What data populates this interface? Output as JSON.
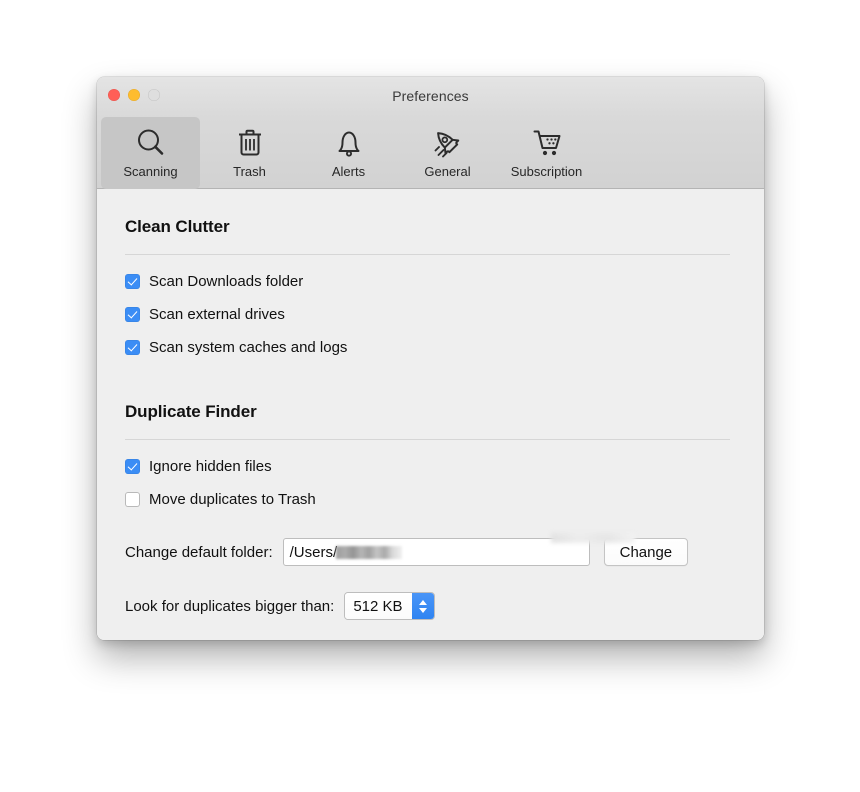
{
  "window": {
    "title": "Preferences",
    "traffic_lights": [
      {
        "name": "close",
        "color": "#ff5f57"
      },
      {
        "name": "minimize",
        "color": "#febc2e"
      },
      {
        "name": "zoom",
        "color": "#dedede"
      }
    ]
  },
  "toolbar": {
    "items": [
      {
        "label": "Scanning",
        "icon": "magnifier-icon",
        "selected": true
      },
      {
        "label": "Trash",
        "icon": "trash-icon",
        "selected": false
      },
      {
        "label": "Alerts",
        "icon": "bell-icon",
        "selected": false
      },
      {
        "label": "General",
        "icon": "rocket-icon",
        "selected": false
      },
      {
        "label": "Subscription",
        "icon": "cart-icon",
        "selected": false
      }
    ]
  },
  "sections": [
    {
      "title": "Clean Clutter",
      "checkboxes": [
        {
          "label": "Scan Downloads folder",
          "checked": true
        },
        {
          "label": "Scan external drives",
          "checked": true
        },
        {
          "label": "Scan system caches and logs",
          "checked": true
        }
      ]
    },
    {
      "title": "Duplicate Finder",
      "checkboxes": [
        {
          "label": "Ignore hidden files",
          "checked": true
        },
        {
          "label": "Move duplicates to Trash",
          "checked": false
        }
      ]
    }
  ],
  "folder_row": {
    "label": "Change default folder:",
    "value": "/Users/",
    "redacted": true,
    "button_label": "Change"
  },
  "size_row": {
    "label": "Look for duplicates bigger than:",
    "value": "512 KB"
  },
  "colors": {
    "accent": "#3b8df5",
    "window_bg": "#efefef",
    "toolbar_bg": "#d5d5d5"
  }
}
